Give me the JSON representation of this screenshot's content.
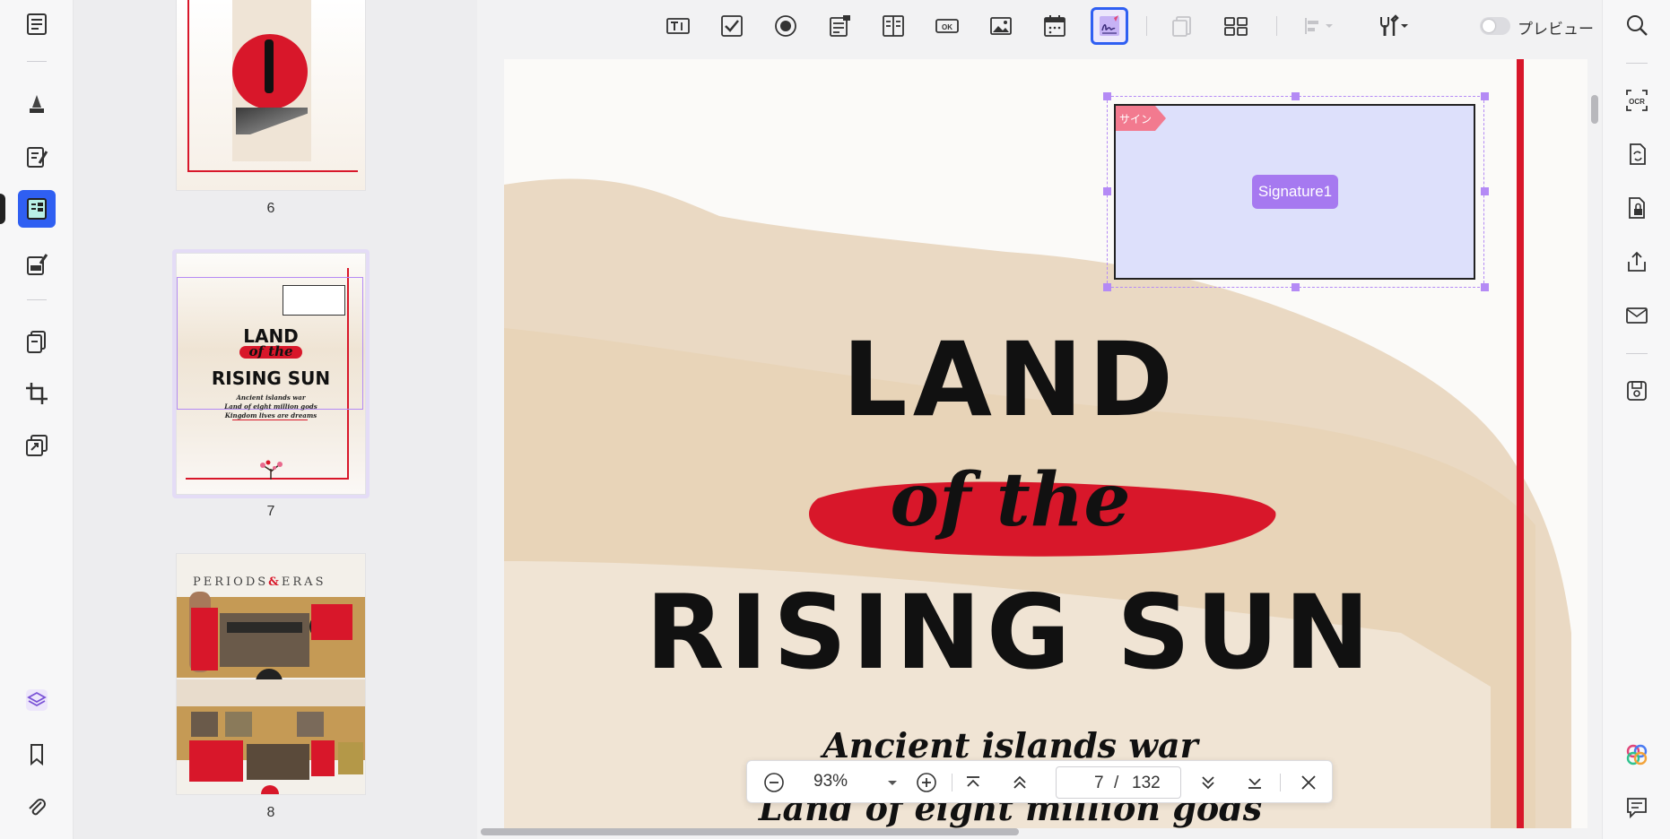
{
  "toolbar": {
    "preview_label": "プレビュー",
    "tools": [
      "text-field",
      "checkbox",
      "radio-button",
      "combo-box",
      "list-box",
      "button",
      "image-field",
      "date-field",
      "signature-field",
      "duplicate",
      "grid",
      "align",
      "tools-menu"
    ]
  },
  "thumbnails": [
    {
      "page_number": "6"
    },
    {
      "page_number": "7",
      "title_line1": "LAND",
      "title_line2": "of the",
      "title_line3": "RISING SUN",
      "script1": "Ancient islands war",
      "script2": "Land of eight million gods",
      "script3": "Kingdom lives are dreams"
    },
    {
      "page_number": "8",
      "title": "PERIODS",
      "amp": "&",
      "title2": "ERAS"
    }
  ],
  "page": {
    "title_line1": "LAND",
    "title_line2": "of the",
    "title_line3": "RISING SUN",
    "script_line1": "Ancient islands war",
    "script_line2": "Land of eight million gods"
  },
  "signature_field": {
    "tag": "サイン",
    "name": "Signature1"
  },
  "zoombar": {
    "zoom": "93%",
    "current_page": "7",
    "separator": "/",
    "total_pages": "132"
  },
  "colors": {
    "accent": "#2f5ff2",
    "signature_fill": "#dde0fb",
    "signature_handle": "#b48af5",
    "signature_badge": "#a679f0",
    "tag_pink": "#f27a8f",
    "brand_red": "#d8172a"
  }
}
